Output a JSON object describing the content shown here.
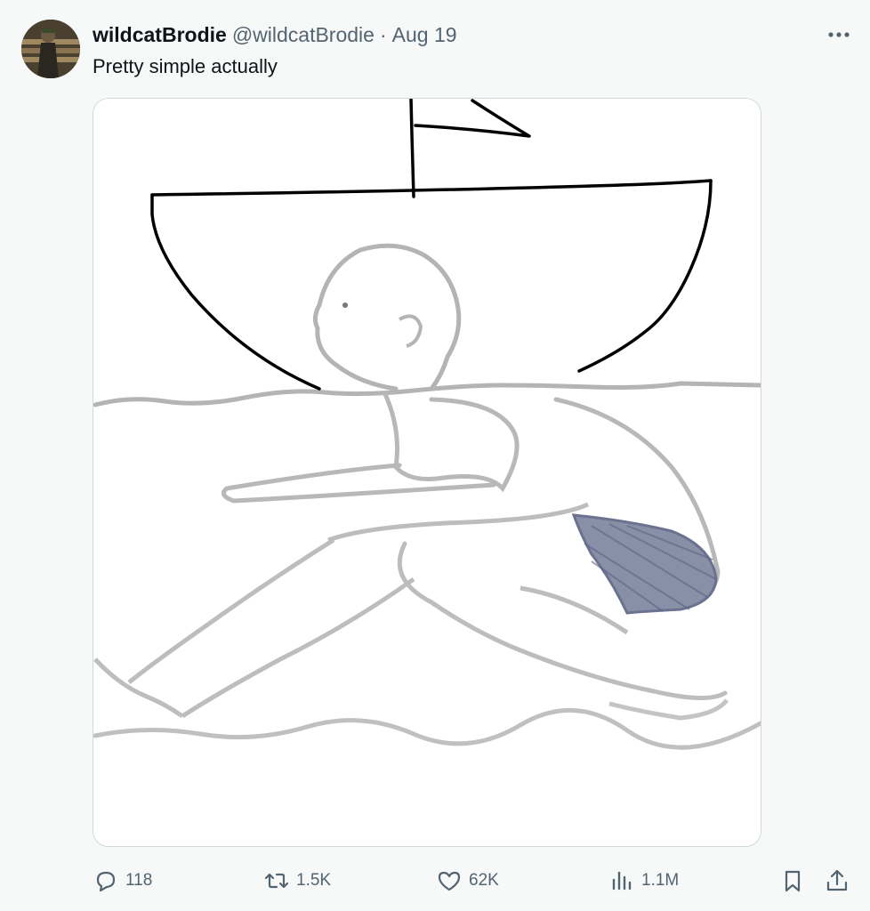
{
  "author": {
    "display_name": "wildcatBrodie",
    "handle": "@wildcatBrodie",
    "separator": "·",
    "date": "Aug 19"
  },
  "tweet": {
    "text": "Pretty simple actually"
  },
  "actions": {
    "reply_count": "118",
    "repost_count": "1.5K",
    "like_count": "62K",
    "view_count": "1.1M"
  },
  "icons": {
    "more": "more-horizontal-icon",
    "reply": "reply-icon",
    "repost": "repost-icon",
    "like": "heart-icon",
    "views": "views-icon",
    "bookmark": "bookmark-icon",
    "share": "share-icon"
  },
  "colors": {
    "background": "#f7f9f9",
    "text_primary": "#0f1419",
    "text_secondary": "#536471",
    "media_border": "#cfd9de"
  }
}
